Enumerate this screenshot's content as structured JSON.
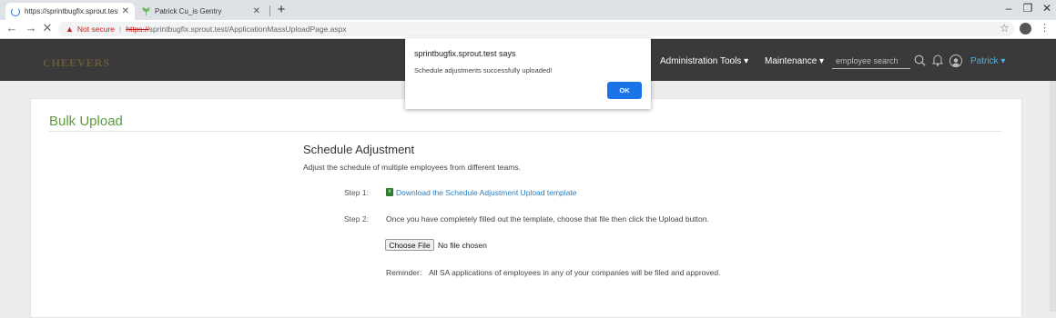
{
  "browser": {
    "tabs": [
      {
        "title": "https://sprintbugfix.sprout.test/A",
        "active": true
      },
      {
        "title": "Patrick Cu_is Gentry",
        "active": false
      }
    ],
    "new_tab_icon": "+",
    "address": {
      "warning": "Not secure",
      "scheme": "https://",
      "rest": "sprintbugfix.sprout.test/ApplicationMassUploadPage.aspx"
    }
  },
  "header": {
    "logo": "CHEEVERS",
    "nav": [
      "Administration Tools",
      "Maintenance"
    ],
    "search_placeholder": "employee search",
    "user": "Patrick"
  },
  "page": {
    "title": "Bulk Upload",
    "section_title": "Schedule Adjustment",
    "section_desc": "Adjust the schedule of multiple employees from different teams.",
    "step1_label": "Step 1:",
    "step1_link": "Download the Schedule Adjustment Upload template",
    "step2_label": "Step 2:",
    "step2_text": "Once you have completely filled out the template, choose that file then click the Upload button.",
    "choose_file": "Choose File",
    "no_file": "No file chosen",
    "reminder_label": "Reminder:",
    "reminder_text": "All SA applications of employees in any of your companies will be filed and approved."
  },
  "dialog": {
    "title": "sprintbugfix.sprout.test says",
    "message": "Schedule adjustments successfully uploaded!",
    "ok": "OK"
  },
  "colors": {
    "accent_green": "#5d9b3b",
    "link_blue": "#2a7fc1",
    "dialog_button": "#1a73e8",
    "header_bg": "#3a3a3a"
  }
}
